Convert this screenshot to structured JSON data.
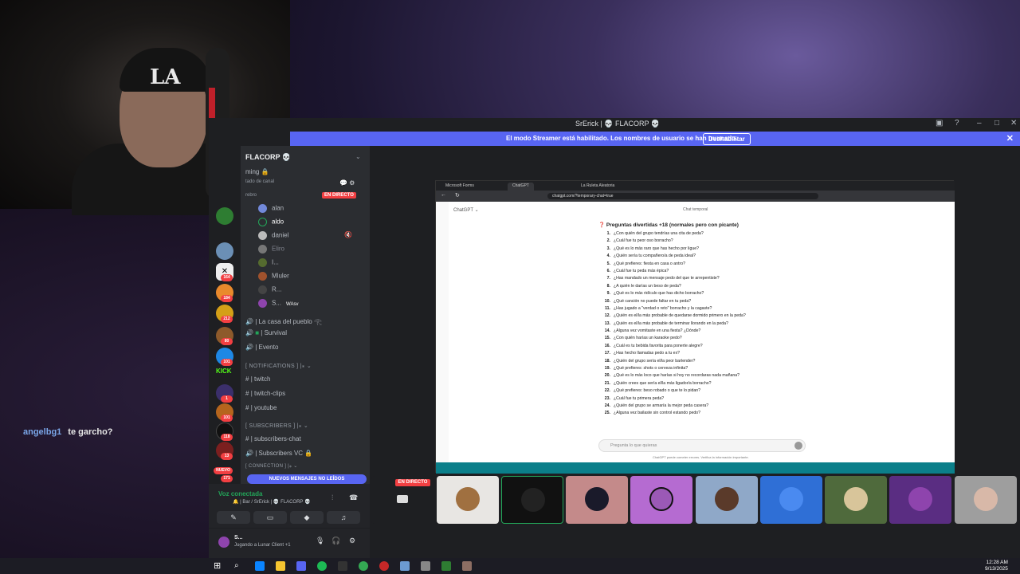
{
  "chat": {
    "user": "angelbg1",
    "text": "te garcho?"
  },
  "webcam": {
    "cap_logo": "LA"
  },
  "discord": {
    "window_title": "SrErick | 💀 FLACORP 💀",
    "banner": {
      "text": "El modo Streamer está habilitado. Los nombres de usuario se han truncado.",
      "button": "Deshabilitar"
    },
    "server_name": "FLACORP 💀",
    "server_sub": "ming 🔒",
    "channel_owner_note": "tado de canal",
    "live_label": "EN DIRECTO",
    "live_member": "rebro",
    "members": [
      "alan",
      "aldo",
      "daniel",
      "Eliro",
      "I...",
      "Mluler",
      "R...",
      "S..."
    ],
    "member_extra": "WAsv",
    "voice_channels": [
      "| La casa del pueblo 𓂀",
      "| Survival",
      "| Evento"
    ],
    "notifications_category": "[ NOTIFICATIONS ] |⁎ ⌄",
    "notification_channels": [
      "| twitch",
      "| twitch-clips",
      "| youtube"
    ],
    "subscribers_category": "[ SUBSCRIBERS ] |⁎ ⌄",
    "subscriber_channels": [
      "| subscribers-chat",
      "| Subscribers VC 🔒"
    ],
    "connection_category": "[ CONNECTION ] |⁎ ⌄",
    "new_messages": "NUEVOS MENSAJES NO LEÍDOS",
    "voice_status": "Voz conectada",
    "voice_location": "🔔 | Bar / SrErick | 💀 FLACORP 💀",
    "user_name": "S...",
    "user_status": "Jugando a Lunar Client +1",
    "server_badges": [
      "164",
      "184",
      "212",
      "80",
      "101",
      "1",
      "101",
      "118",
      "13",
      "171"
    ],
    "kick_label": "KICK",
    "nuevo_label": "NUEVO",
    "stage_live": "EN DIRECTO"
  },
  "browser": {
    "tabs": [
      "Microsoft Forms",
      "ChatGPT",
      "La Ruleta Aleatoria"
    ],
    "url": "chatgpt.com/?temporary-chat=true"
  },
  "chatgpt": {
    "brand": "ChatGPT ⌄",
    "temporary": "Chat temporal",
    "heading": "Preguntas divertidas +18 (normales pero con picante)",
    "questions": [
      "¿Con quién del grupo tendrías una cita de peda?",
      "¿Cuál fue tu peor oso borracho?",
      "¿Qué es lo más raro que has hecho por ligue?",
      "¿Quién sería tu compañero/a de peda ideal?",
      "¿Qué prefieres: fiesta en casa o antro?",
      "¿Cuál fue tu peda más épica?",
      "¿Has mandado un mensaje pedo del que te arrepentiste?",
      "¿A quién le darías un beso de peda?",
      "¿Qué es lo más ridículo que has dicho borracho?",
      "¿Qué canción no puede faltar en tu peda?",
      "¿Has jugado a \"verdad o reto\" borracho y la cagaste?",
      "¿Quién es el/la más probable de quedarse dormido primero en la peda?",
      "¿Quién es el/la más probable de terminar llorando en la peda?",
      "¿Alguna vez vomitaste en una fiesta? ¿Dónde?",
      "¿Con quién harías un karaoke pedo?",
      "¿Cuál es tu bebida favorita para ponerte alegre?",
      "¿Has hecho llamadas pedo a tu ex?",
      "¿Quién del grupo sería el/la peor bartender?",
      "¿Qué prefieres: shots o cerveza infinita?",
      "¿Qué es lo más loco que harías si hoy no recordaras nada mañana?",
      "¿Quién crees que sería el/la más ligador/a borracho?",
      "¿Qué prefieres: beso robado o que te lo pidan?",
      "¿Cuál fue tu primera peda?",
      "¿Quién del grupo se armaría la mejor peda casera?",
      "¿Alguna vez bailaste sin control estando pedo?"
    ],
    "input_placeholder": "Pregunta lo que quieras",
    "footer_note": "ChatGPT puede cometer errores. Verifica la información importante."
  },
  "taskbar": {
    "time": "12:28 AM",
    "date": "9/13/2025"
  },
  "colors": {
    "discord_blurple": "#5865f2",
    "live_red": "#f23f42",
    "voice_green": "#23a559"
  }
}
